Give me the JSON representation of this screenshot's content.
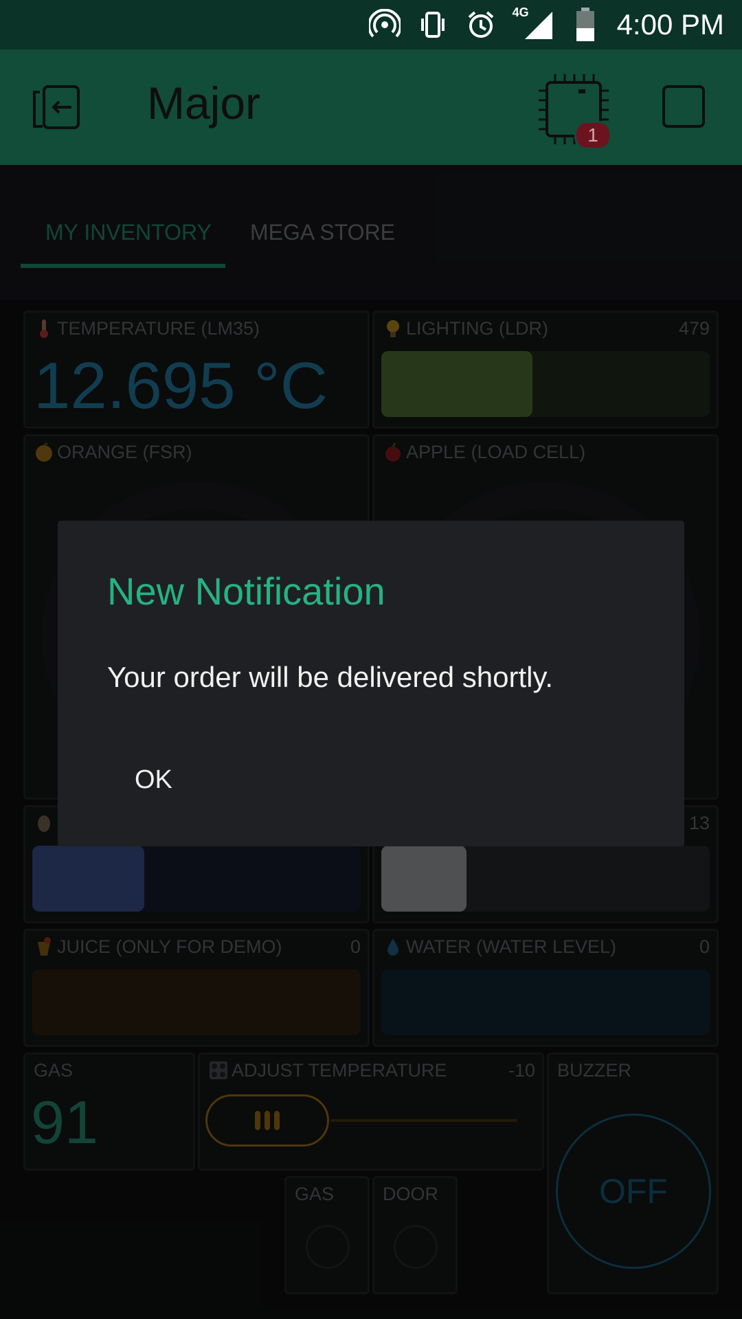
{
  "status_bar": {
    "time": "4:00 PM",
    "network": "4G",
    "icons": [
      "hotspot-icon",
      "vibrate-icon",
      "alarm-icon",
      "signal-icon",
      "battery-icon"
    ]
  },
  "app_bar": {
    "title": "Major",
    "device_badge": "1",
    "icons": [
      "exit-icon",
      "chip-icon",
      "square-icon"
    ]
  },
  "tabs": [
    {
      "label": "MY INVENTORY",
      "active": true
    },
    {
      "label": "MEGA STORE",
      "active": false
    }
  ],
  "widgets": {
    "temperature": {
      "label": "TEMPERATURE (LM35)",
      "value": "12.695 °C",
      "icon": "thermometer-icon"
    },
    "lighting": {
      "label": "LIGHTING (LDR)",
      "value": "479",
      "level": 0.46,
      "icon": "bulb-icon"
    },
    "orange": {
      "label": "ORANGE (FSR)",
      "icon": "orange-icon"
    },
    "apple": {
      "label": "APPLE (LOAD CELL)",
      "icon": "apple-icon"
    },
    "egg": {
      "icon": "egg-icon",
      "level": 0.34
    },
    "milk": {
      "value": "13",
      "level": 0.26
    },
    "juice": {
      "label": "JUICE (ONLY FOR DEMO)",
      "value": "0",
      "icon": "juice-icon"
    },
    "water": {
      "label": "WATER (WATER LEVEL)",
      "value": "0",
      "icon": "drop-icon"
    },
    "gas": {
      "label": "GAS",
      "value": "91"
    },
    "adjust_temp": {
      "label": "ADJUST TEMPERATURE",
      "value": "-10",
      "icon": "stove-icon"
    },
    "buzzer": {
      "label": "BUZZER",
      "button": "OFF"
    },
    "gas_led": {
      "label": "GAS"
    },
    "door_led": {
      "label": "DOOR"
    }
  },
  "colors": {
    "accent": "#25b383",
    "app_bar": "#114d39",
    "temperature_value": "#1b5f7d",
    "gas_value": "#1d6b55"
  },
  "dialog": {
    "title": "New Notification",
    "message": "Your order will be delivered shortly.",
    "ok": "OK"
  }
}
